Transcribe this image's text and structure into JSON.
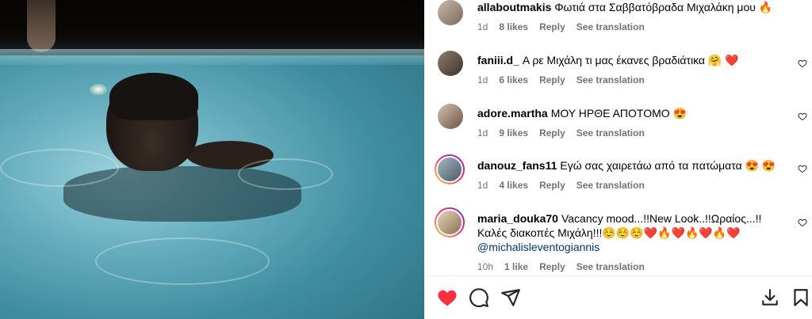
{
  "comments": [
    {
      "user": "allaboutmakis",
      "text": "Φωτιά στα Σαββατόβραδα Μιχαλάκη μου 🔥",
      "time": "1d",
      "likes": "8 likes",
      "reply": "Reply",
      "translation": "See translation"
    },
    {
      "user": "faniii.d_",
      "text": "Α ρε Μιχάλη τι μας έκανες βραδιάτικα 🤗 ❤️",
      "time": "1d",
      "likes": "6 likes",
      "reply": "Reply",
      "translation": "See translation"
    },
    {
      "user": "adore.martha",
      "text": "ΜΟΥ ΗΡΘΕ ΑΠΟΤΟΜΟ 😍",
      "time": "1d",
      "likes": "9 likes",
      "reply": "Reply",
      "translation": "See translation"
    },
    {
      "user": "danouz_fans11",
      "text": "Εγώ σας χαιρετάω από τα πατώματα 😍 😍",
      "time": "1d",
      "likes": "4 likes",
      "reply": "Reply",
      "translation": "See translation"
    },
    {
      "user": "maria_douka70",
      "text": "Vacancy mood...!!New Look..!!Ωραίος...!!Καλές διακοπές Μιχάλη!!!☺️☺️☺️❤️🔥❤️🔥❤️🔥❤️",
      "mention": "@michalisleventogiannis",
      "time": "10h",
      "likes": "1 like",
      "reply": "Reply",
      "translation": "See translation"
    }
  ],
  "icons": {
    "like": "heart-filled-icon",
    "comment": "comment-bubble-icon",
    "share": "paper-plane-icon",
    "download": "download-icon",
    "save": "bookmark-icon",
    "comment_like": "heart-outline-icon"
  },
  "colors": {
    "like_red": "#ff3040",
    "meta_gray": "#737373",
    "mention_blue": "#00376b"
  }
}
